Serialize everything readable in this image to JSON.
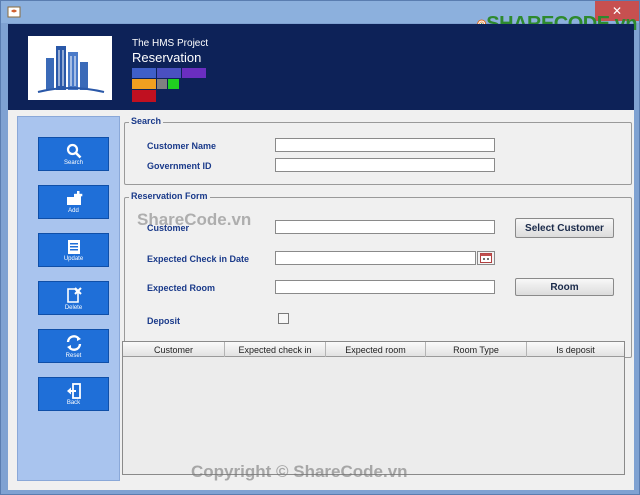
{
  "header": {
    "subtitle": "The HMS Project",
    "title": "Reservation"
  },
  "watermark": {
    "logo": "SHARECODE.vn",
    "mid": "ShareCode.vn",
    "bottom": "Copyright © ShareCode.vn"
  },
  "sidebar": {
    "items": [
      {
        "label": "Search",
        "icon": "search-icon"
      },
      {
        "label": "Add",
        "icon": "add-icon"
      },
      {
        "label": "Update",
        "icon": "update-icon"
      },
      {
        "label": "Delete",
        "icon": "delete-icon"
      },
      {
        "label": "Reset",
        "icon": "reset-icon"
      },
      {
        "label": "Back",
        "icon": "back-icon"
      }
    ]
  },
  "search": {
    "title": "Search",
    "customer_name_label": "Customer Name",
    "customer_name_value": "",
    "government_id_label": "Government ID",
    "government_id_value": ""
  },
  "reservation_form": {
    "title": "Reservation Form",
    "customer_label": "Customer",
    "customer_value": "",
    "select_customer_button": "Select Customer",
    "check_in_label": "Expected Check in Date",
    "check_in_value": "",
    "room_label": "Expected Room",
    "room_value": "",
    "room_button": "Room",
    "deposit_label": "Deposit",
    "deposit_checked": false
  },
  "table": {
    "columns": [
      "Customer",
      "Expected check in",
      "Expected room",
      "Room Type",
      "Is deposit"
    ],
    "rows": []
  },
  "colors": {
    "header_bg": "#0d2258",
    "sidebar_bg": "#a9c4ee",
    "sidebar_button": "#1f6fd8",
    "label_text": "#1a3a8a"
  }
}
